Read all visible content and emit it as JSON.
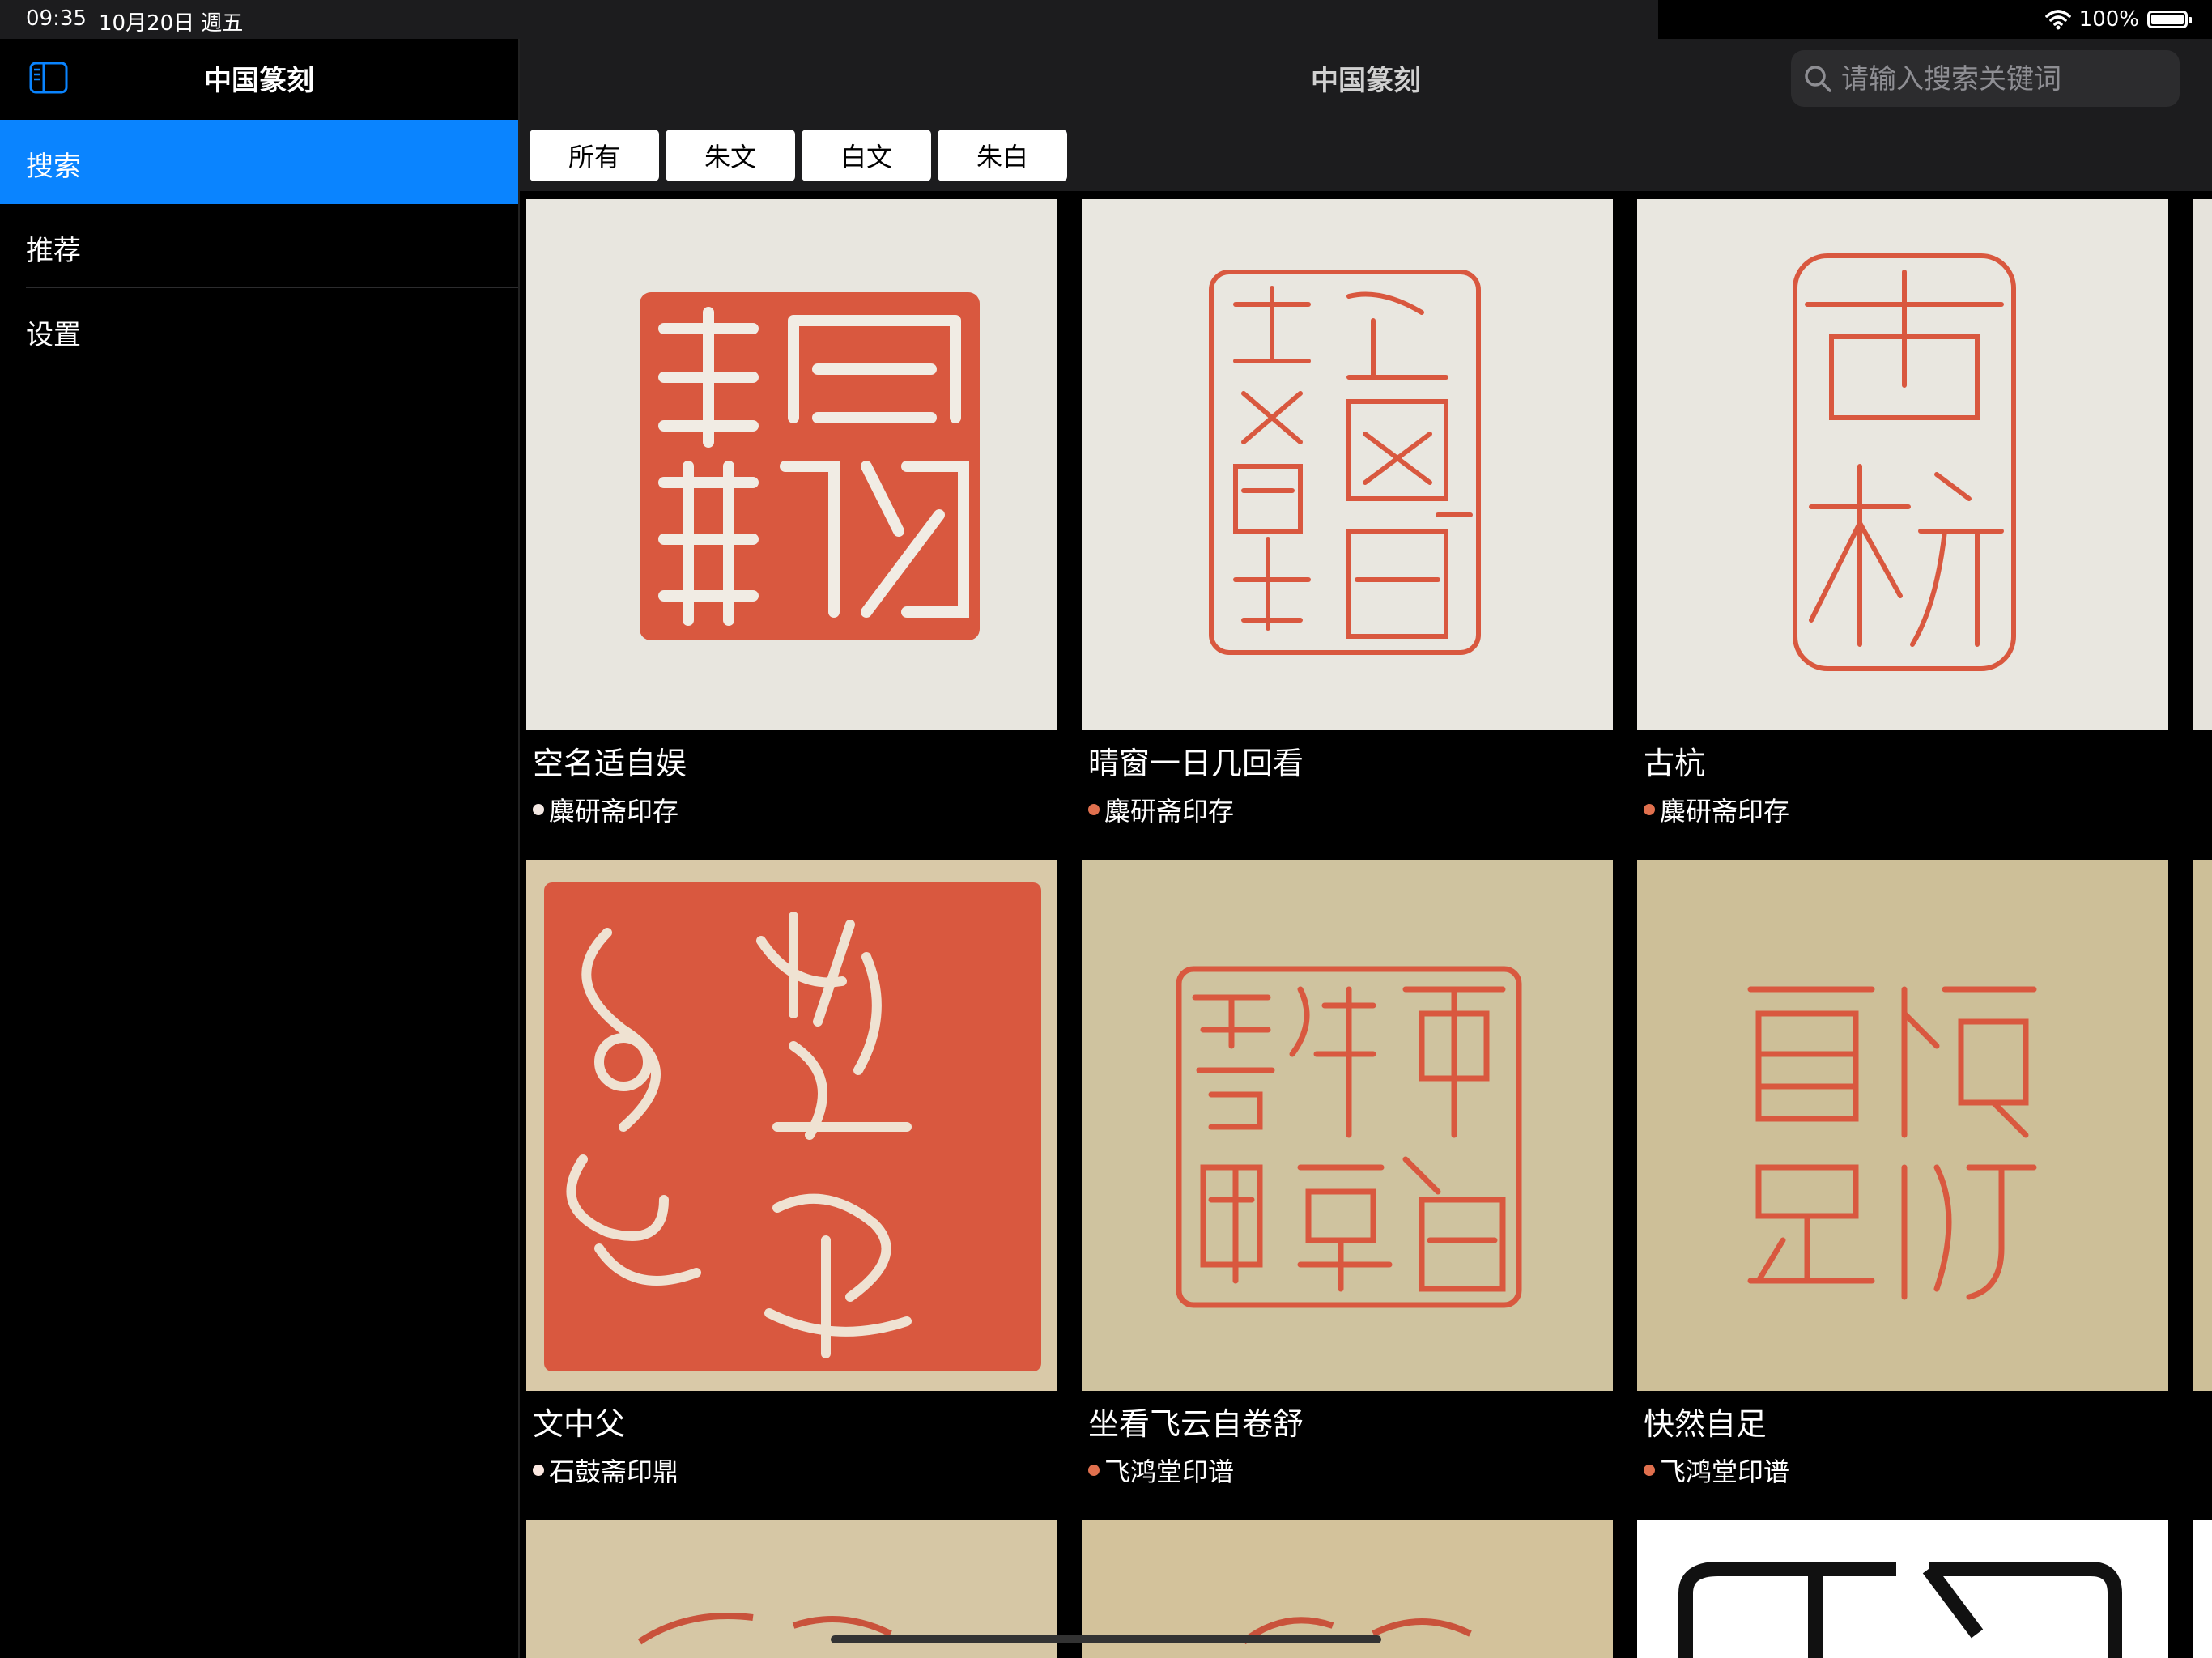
{
  "status": {
    "time": "09:35",
    "date": "10月20日 週五",
    "battery": "100%"
  },
  "sidebar": {
    "title": "中国篆刻",
    "items": [
      {
        "label": "搜索",
        "active": true
      },
      {
        "label": "推荐",
        "active": false
      },
      {
        "label": "设置",
        "active": false
      }
    ]
  },
  "main": {
    "title": "中国篆刻",
    "search": {
      "placeholder": "请输入搜索关键词",
      "value": ""
    },
    "filters": [
      "所有",
      "朱文",
      "白文",
      "朱白"
    ],
    "cards": [
      {
        "title": "空名适自娱",
        "source": "麋研斋印存",
        "paper": "#e8e6df",
        "dot": "#f3e7e2"
      },
      {
        "title": "晴窗一日几回看",
        "source": "麋研斋印存",
        "paper": "#e9e7e0",
        "dot": "#e0704e"
      },
      {
        "title": "古杭",
        "source": "麋研斋印存",
        "paper": "#e9e7e0",
        "dot": "#e0704e"
      },
      {
        "title": "文中父",
        "source": "石鼓斋印鼎",
        "paper": "#d9c9a8",
        "dot": "#fbe7e0"
      },
      {
        "title": "坐看飞云自卷舒",
        "source": "飞鸿堂印谱",
        "paper": "#cfc39f",
        "dot": "#e0704e"
      },
      {
        "title": "快然自足",
        "source": "飞鸿堂印谱",
        "paper": "#cdbf98",
        "dot": "#e0704e"
      }
    ],
    "seal_color": "#d9583f"
  }
}
